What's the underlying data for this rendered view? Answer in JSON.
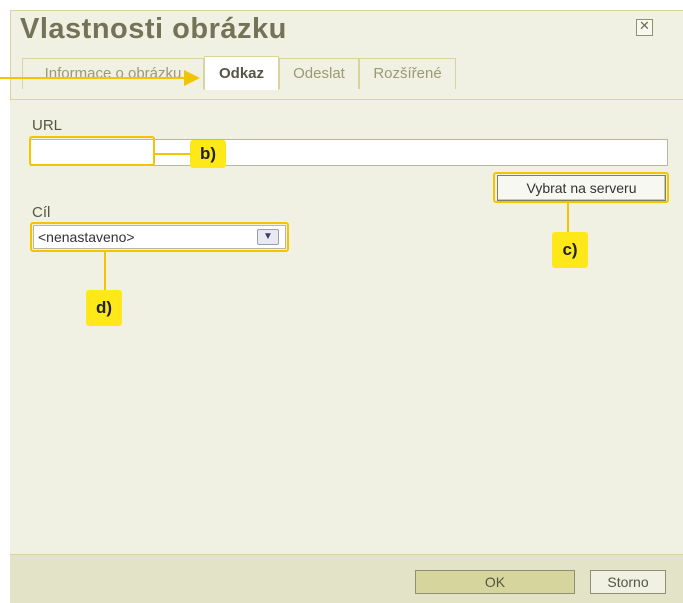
{
  "dialog": {
    "title": "Vlastnosti obrázku",
    "close_icon": "close-icon"
  },
  "tabs": [
    {
      "label": "Informace o obrázku",
      "active": false
    },
    {
      "label": "Odkaz",
      "active": true
    },
    {
      "label": "Odeslat",
      "active": false
    },
    {
      "label": "Rozšířené",
      "active": false
    }
  ],
  "link": {
    "url_label": "URL",
    "url_value": "",
    "browse_label": "Vybrat na serveru",
    "target_label": "Cíl",
    "target_value": "<nenastaveno>"
  },
  "footer": {
    "ok_label": "OK",
    "cancel_label": "Storno"
  },
  "annotations": {
    "b": "b)",
    "c": "c)",
    "d": "d)"
  },
  "colors": {
    "accent": "#f5c400",
    "callout_bg": "#ffe81a",
    "dialog_bg": "#f1f1e3",
    "title_text": "#737357"
  }
}
